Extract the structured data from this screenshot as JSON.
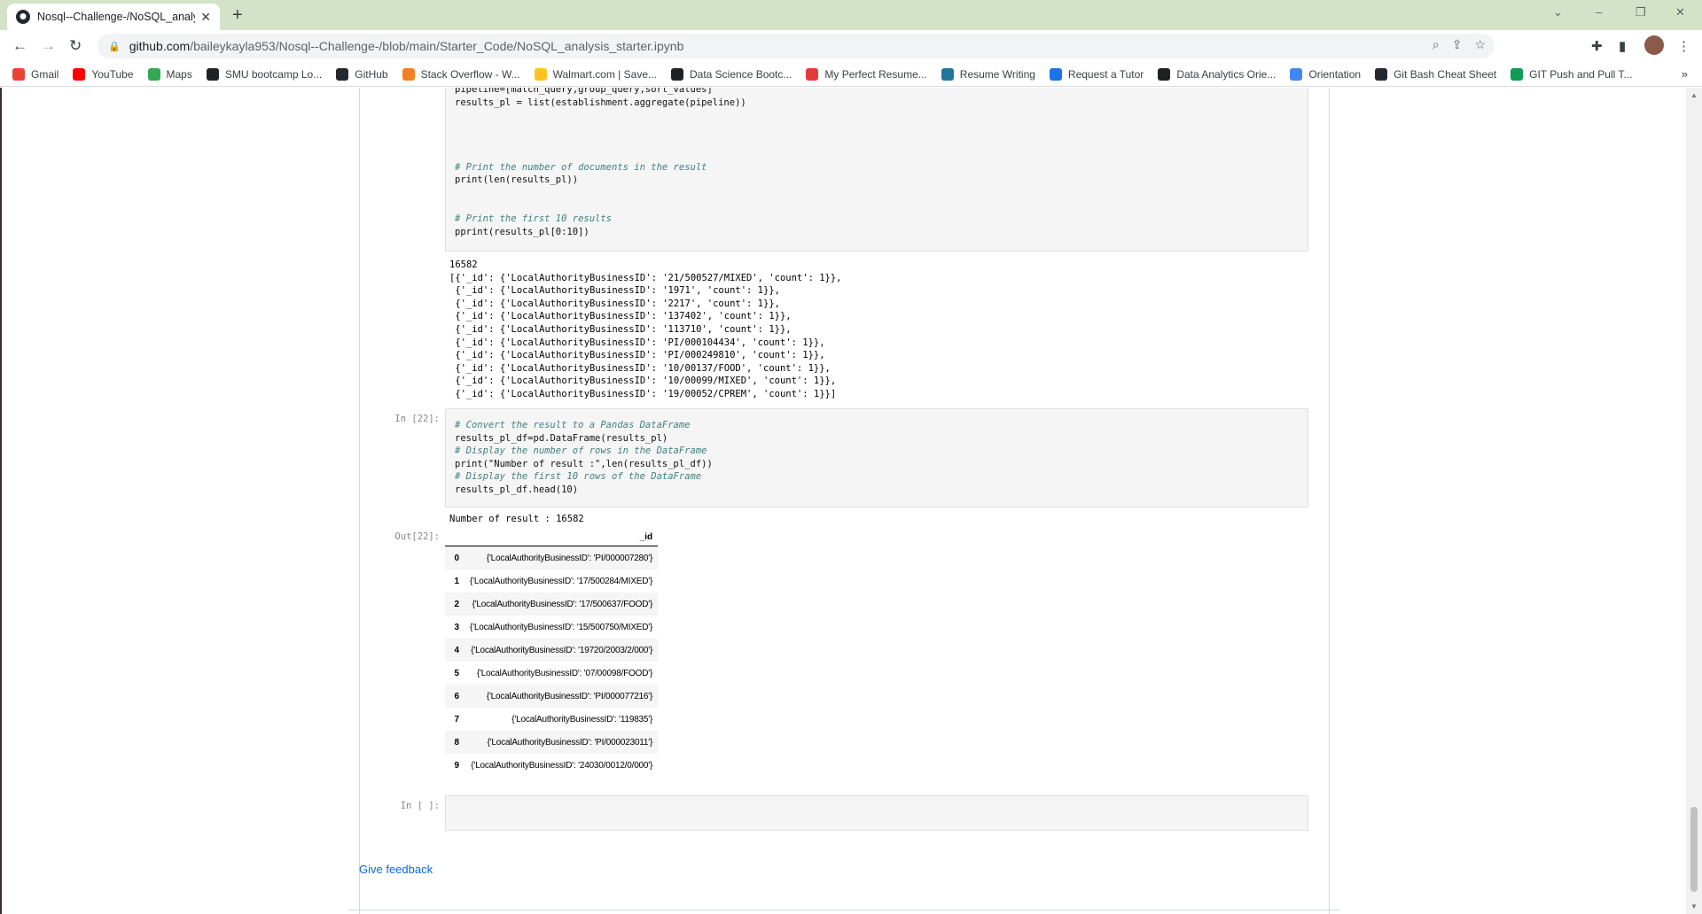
{
  "browser": {
    "tab_title": "Nosql--Challenge-/NoSQL_analy",
    "tab_close": "✕",
    "new_tab": "+",
    "url_host": "github.com",
    "url_path": "/baileykayla953/Nosql--Challenge-/blob/main/Starter_Code/NoSQL_analysis_starter.ipynb",
    "window_controls": [
      "⌄",
      "–",
      "❐",
      "✕"
    ],
    "bookmarks": [
      {
        "label": "Gmail",
        "color": "#ea4335"
      },
      {
        "label": "YouTube",
        "color": "#ff0000"
      },
      {
        "label": "Maps",
        "color": "#34a853"
      },
      {
        "label": "SMU bootcamp Lo...",
        "color": "#202124"
      },
      {
        "label": "GitHub",
        "color": "#24292f"
      },
      {
        "label": "Stack Overflow - W...",
        "color": "#f48024"
      },
      {
        "label": "Walmart.com | Save...",
        "color": "#ffc220"
      },
      {
        "label": "Data Science Bootc...",
        "color": "#202124"
      },
      {
        "label": "My Perfect Resume...",
        "color": "#e23c3c"
      },
      {
        "label": "Resume Writing",
        "color": "#21759b"
      },
      {
        "label": "Request a Tutor",
        "color": "#1a73e8"
      },
      {
        "label": "Data Analytics Orie...",
        "color": "#202124"
      },
      {
        "label": "Orientation",
        "color": "#4285f4"
      },
      {
        "label": "Git Bash Cheat Sheet",
        "color": "#24292f"
      },
      {
        "label": "GIT Push and Pull T...",
        "color": "#0f9d58"
      }
    ],
    "bookmarks_more": "»"
  },
  "notebook": {
    "cell21_code": [
      "pipeline=[match_query,group_query,sort_values]",
      "results_pl = list(establishment.aggregate(pipeline))",
      "",
      "",
      "",
      "",
      "# Print the number of documents in the result",
      "print(len(results_pl))",
      "",
      "",
      "# Print the first 10 results",
      "pprint(results_pl[0:10])"
    ],
    "cell21_output": [
      "16582",
      "[{'_id': {'LocalAuthorityBusinessID': '21/500527/MIXED', 'count': 1}},",
      " {'_id': {'LocalAuthorityBusinessID': '1971', 'count': 1}},",
      " {'_id': {'LocalAuthorityBusinessID': '2217', 'count': 1}},",
      " {'_id': {'LocalAuthorityBusinessID': '137402', 'count': 1}},",
      " {'_id': {'LocalAuthorityBusinessID': '113710', 'count': 1}},",
      " {'_id': {'LocalAuthorityBusinessID': 'PI/000104434', 'count': 1}},",
      " {'_id': {'LocalAuthorityBusinessID': 'PI/000249810', 'count': 1}},",
      " {'_id': {'LocalAuthorityBusinessID': '10/00137/FOOD', 'count': 1}},",
      " {'_id': {'LocalAuthorityBusinessID': '10/00099/MIXED', 'count': 1}},",
      " {'_id': {'LocalAuthorityBusinessID': '19/00052/CPREM', 'count': 1}}]"
    ],
    "cell22_prompt": "In [22]:",
    "cell22_code": [
      "# Convert the result to a Pandas DataFrame",
      "results_pl_df=pd.DataFrame(results_pl)",
      "# Display the number of rows in the DataFrame",
      "print(\"Number of result :\",len(results_pl_df))",
      "# Display the first 10 rows of the DataFrame",
      "results_pl_df.head(10)"
    ],
    "cell22_stdout": "Number of result : 16582",
    "out22_prompt": "Out[22]:",
    "df_header": "_id",
    "df_rows": [
      {
        "index": "0",
        "value": "{'LocalAuthorityBusinessID': 'PI/000007280'}"
      },
      {
        "index": "1",
        "value": "{'LocalAuthorityBusinessID': '17/500284/MIXED'}"
      },
      {
        "index": "2",
        "value": "{'LocalAuthorityBusinessID': '17/500637/FOOD'}"
      },
      {
        "index": "3",
        "value": "{'LocalAuthorityBusinessID': '15/500750/MIXED'}"
      },
      {
        "index": "4",
        "value": "{'LocalAuthorityBusinessID': '19720/2003/2/000'}"
      },
      {
        "index": "5",
        "value": "{'LocalAuthorityBusinessID': '07/00098/FOOD'}"
      },
      {
        "index": "6",
        "value": "{'LocalAuthorityBusinessID': 'PI/000077216'}"
      },
      {
        "index": "7",
        "value": "{'LocalAuthorityBusinessID': '119835'}"
      },
      {
        "index": "8",
        "value": "{'LocalAuthorityBusinessID': 'PI/000023011'}"
      },
      {
        "index": "9",
        "value": "{'LocalAuthorityBusinessID': '24030/0012/0/000'}"
      }
    ],
    "empty_prompt": "In [ ]:"
  },
  "footer": {
    "feedback_link": "Give feedback"
  }
}
